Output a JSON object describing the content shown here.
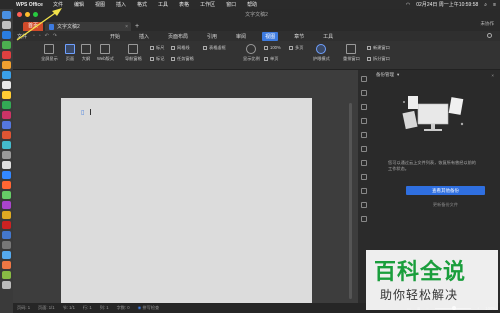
{
  "menubar": {
    "app_name": "WPS Office",
    "items": [
      "文件",
      "编辑",
      "视图",
      "插入",
      "格式",
      "工具",
      "表格",
      "工作区",
      "窗口",
      "帮助"
    ],
    "clock": "02月24日 周一上午10:59:58"
  },
  "window": {
    "title": "文字文稿2",
    "home_tab": "首页",
    "doc_tab": "文字文稿2",
    "collab_label": "未协作"
  },
  "ribbon_tabs": {
    "file": "文件",
    "tabs": [
      "开始",
      "插入",
      "页面布局",
      "引用",
      "审阅",
      "视图",
      "章节",
      "工具"
    ],
    "active": "视图"
  },
  "ribbon": {
    "full_screen": "全屏显示",
    "page": "页面",
    "outline": "大纲",
    "web": "Web版式",
    "nav_pane": "导航窗格",
    "ruler": "标尺",
    "grid": "网格线",
    "table_borders": "表格虚框",
    "marks": "标记",
    "task_pane": "任务窗格",
    "zoom": "显示比例",
    "zoom_pct": "100%",
    "single_page": "单页",
    "multi_page": "多页",
    "eye_mode": "护眼模式",
    "rearrange": "重排窗口",
    "new_window": "新建窗口",
    "split_window": "拆分窗口"
  },
  "panel": {
    "title": "备份管理",
    "message": "您可以通过云上文件列表，恢复所有曾经以前的工作状态。",
    "primary": "查看其他备份",
    "secondary": "更新备份文件"
  },
  "statusbar": {
    "page": "页码: 1",
    "pages": "页面: 1/1",
    "section": "节: 1/1",
    "row": "行: 1",
    "col": "列: 1",
    "words": "字数: 0",
    "spell": "拼写检查",
    "zoom": "100%"
  },
  "watermark": {
    "title": "百科全说",
    "subtitle": "助你轻松解决"
  },
  "colors": {
    "accent": "#3d7be0",
    "home_tab": "#d04a2a",
    "watermark_green": "#1a9e3c",
    "arrow": "#f2e24a"
  }
}
